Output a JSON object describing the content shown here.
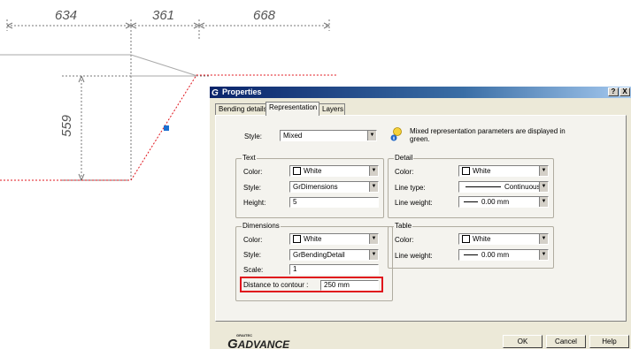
{
  "drawing": {
    "dims": [
      "634",
      "361",
      "668",
      "559"
    ]
  },
  "dialog": {
    "title": "Properties",
    "title_help": "?",
    "title_close": "X",
    "tabs": [
      "Bending details",
      "Representation",
      "Layers"
    ],
    "active_tab": 1,
    "style_label": "Style:",
    "style_value": "Mixed",
    "info_text_line1": "Mixed representation parameters are displayed in",
    "info_text_line2": "green.",
    "text_group": {
      "title": "Text",
      "color_label": "Color:",
      "color_value": "White",
      "style_label": "Style:",
      "style_value": "GrDimensions",
      "height_label": "Height:",
      "height_value": "5"
    },
    "detail_group": {
      "title": "Detail",
      "color_label": "Color:",
      "color_value": "White",
      "linetype_label": "Line type:",
      "linetype_value": "Continuous",
      "lineweight_label": "Line weight:",
      "lineweight_value": "0.00 mm"
    },
    "dimensions_group": {
      "title": "Dimensions",
      "color_label": "Color:",
      "color_value": "White",
      "style_label": "Style:",
      "style_value": "GrBendingDetail",
      "scale_label": "Scale:",
      "scale_value": "1",
      "distance_label": "Distance to contour :",
      "distance_value": "250 mm"
    },
    "table_group": {
      "title": "Table",
      "color_label": "Color:",
      "color_value": "White",
      "lineweight_label": "Line weight:",
      "lineweight_value": "0.00 mm"
    },
    "logo_small": "GRAITEC",
    "logo_text": "ADVANCE",
    "logo_g": "G",
    "ok_label": "OK",
    "cancel_label": "Cancel",
    "help_label": "Help"
  },
  "colors": {
    "highlight": "#e0141c",
    "title_start": "#0a246a",
    "contour": "#e0141c",
    "grip": "#1c6fd0"
  }
}
